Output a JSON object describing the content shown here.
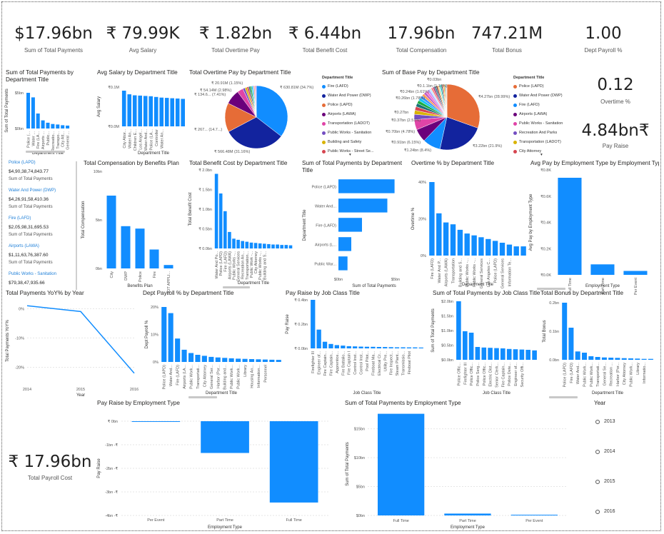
{
  "colors": {
    "bar": "#118DFF",
    "accent": "#1e7fd8"
  },
  "kpis": [
    {
      "value": "$17.96bn",
      "label": "Sum of Total Payments"
    },
    {
      "value": "₹ 79.99K",
      "label": "Avg Salary"
    },
    {
      "value": "₹ 1.82bn",
      "label": "Total Overtime Pay"
    },
    {
      "value": "₹ 6.44bn",
      "label": "Total Benefit Cost"
    },
    {
      "value": "17.96bn",
      "label": "Total Compensation"
    },
    {
      "value": "747.21M",
      "label": "Total Bonus"
    },
    {
      "value": "1.00",
      "label": "Dept Payroll %"
    }
  ],
  "side_kpis": [
    {
      "value": "0.12",
      "label": "Overtime %"
    },
    {
      "value": "4.84bn₹",
      "label": "Pay Raise"
    }
  ],
  "payroll_cost": {
    "value": "₹ 17.96bn",
    "label": "Total Payroll Cost"
  },
  "card_list": [
    {
      "name": "Police (LAPD)",
      "value": "$4,90,38,74,843.77",
      "sub": "Sum of Total Payments"
    },
    {
      "name": "Water And Power (DWP)",
      "value": "$4,26,91,58,410.36",
      "sub": "Sum of Total Payments"
    },
    {
      "name": "Fire (LAFD)",
      "value": "$2,05,98,31,695.53",
      "sub": "Sum of Total Payments"
    },
    {
      "name": "Airports (LAWA)",
      "value": "$1,11,63,76,387.60",
      "sub": "Sum of Total Payments"
    },
    {
      "name": "Public Works - Sanitation",
      "value": "$79,38,47,935.66",
      "sub": ""
    }
  ],
  "years": {
    "title": "Year",
    "items": [
      "2013",
      "2014",
      "2015",
      "2016"
    ]
  },
  "charts": {
    "dept_payments": {
      "title": "Sum of Total Payments by Department Title",
      "ylabel": "Sum of Total Payments",
      "xlabel": "Department Title",
      "ticks": [
        "$5bn",
        "$0bn"
      ],
      "categories": [
        "Police (...",
        "Water ...",
        "Fire (LA...",
        "Airports ...",
        "Public...",
        "Recreatio...",
        "Transpo...",
        "City Att...",
        "General ..."
      ],
      "values": [
        4.9,
        4.27,
        2.06,
        1.12,
        0.79,
        0.62,
        0.55,
        0.45,
        0.4
      ]
    },
    "avg_salary": {
      "title": "Avg Salary by Department Title",
      "ylabel": "Avg Salary",
      "xlabel": "Department Title",
      "ticks": [
        "₹0.1M",
        "₹0.0M"
      ],
      "categories": [
        "City Attor...",
        "Water An...",
        "Children E...",
        "Los Angel...",
        "Water And...",
        "Police (LA...",
        "Controller",
        "Water An..."
      ],
      "values": [
        0.109,
        0.098,
        0.095,
        0.094,
        0.093,
        0.092,
        0.09,
        0.088,
        0.087,
        0.086,
        0.085,
        0.084
      ]
    },
    "overtime_pie": {
      "title": "Total Overtime Pay by Department Title",
      "labels": [
        "₹ 630.81M (34.7%)",
        "₹ 566.48M (31.16%)",
        "₹ 267... (14.7...)",
        "₹ 134.6... (7.41%)",
        "₹ 54.14M (2.98%)",
        "₹ 20.91M (1.15%)"
      ],
      "values": [
        34.7,
        31.16,
        14.7,
        7.41,
        2.98,
        1.15,
        1.0,
        0.9,
        0.8,
        0.7,
        0.6,
        0.5,
        0.5,
        0.4,
        0.4
      ],
      "legend_title": "Department Title",
      "legend": [
        "Fire (LAFD)",
        "Water And Power (DWP)",
        "Police (LAPD)",
        "Airports (LAWA)",
        "Transportation (LADOT)",
        "Public Works - Sanitation",
        "Building and Safety",
        "Public Works - Street Se..."
      ],
      "colors": [
        "#118DFF",
        "#12239E",
        "#E66C37",
        "#6B007B",
        "#E044A7",
        "#744EC2",
        "#D9B300",
        "#D64550",
        "#197278",
        "#1AAB40",
        "#15C6F4",
        "#4092FF",
        "#FFA058",
        "#BE5DC9",
        "#F472D0"
      ]
    },
    "base_pie": {
      "title": "Sum of Base Pay by Department Title",
      "labels": [
        "₹4.27bn (28.99%)",
        "₹3.22bn (21.9%)",
        "₹1.24bn (8.4%)",
        "₹0.91bn (6.15%)",
        "₹0.70bn (4.78%)",
        "₹0.37bn (2.51%)",
        "₹0.27bn",
        "₹0.26bn (1.78%)",
        "₹0.24bn (1.61%)",
        "₹0.1.1bn (1.13%)",
        "₹0.03bn"
      ],
      "values": [
        28.99,
        21.9,
        8.4,
        6.15,
        4.78,
        2.51,
        1.9,
        1.78,
        1.61,
        1.5,
        1.4,
        1.3,
        1.2,
        1.13,
        1.1,
        1.0,
        0.9,
        0.9,
        0.8,
        0.8,
        0.7,
        0.7,
        0.6,
        0.6,
        0.5,
        0.5,
        0.5,
        0.4,
        0.4,
        0.3
      ],
      "legend_title": "Department Title",
      "legend": [
        "Police (LAPD)",
        "Water And Power (DWP)",
        "Fire (LAFD)",
        "Airports (LAWA)",
        "Public Works - Sanitation",
        "Recreation And Parks",
        "Transportation (LADOT)",
        "City Attorney"
      ],
      "colors": [
        "#E66C37",
        "#12239E",
        "#118DFF",
        "#6B007B",
        "#E044A7",
        "#744EC2",
        "#D9B300",
        "#D64550",
        "#197278",
        "#1AAB40",
        "#15C6F4",
        "#4092FF",
        "#FFA058",
        "#BE5DC9",
        "#F472D0",
        "#B5A1FF",
        "#C4ECFF",
        "#FF8080",
        "#A43B76",
        "#2F7C93",
        "#7F312F",
        "#FFCB6B",
        "#8AD4EB",
        "#01B8AA",
        "#374649",
        "#FD625E",
        "#F2C80F",
        "#5F6B6D",
        "#8AD4EB",
        "#FE9666"
      ]
    },
    "benefits_plan": {
      "title": "Total Compensation by Benefits Plan",
      "ylabel": "Total Compensation",
      "xlabel": "Benefits Plan",
      "ticks": [
        "10bn",
        "5bn",
        "0bn"
      ],
      "categories": [
        "City",
        "DWP",
        "Police",
        "Fire",
        "NOT APPLI..."
      ],
      "values": [
        7.5,
        4.35,
        4.1,
        1.95,
        0.35
      ]
    },
    "benefit_cost": {
      "title": "Total Benefit Cost by Department Title",
      "ylabel": "Total Benefit Cost",
      "xlabel": "Department Title",
      "ticks": [
        "₹ 2.0bn",
        "₹ 1.5bn",
        "₹ 1.0bn",
        "₹ 0.5bn",
        "₹ 0.0bn"
      ],
      "categories": [
        "Water And Po...",
        "Police (LAPD)",
        "Fire (LAFD)",
        "Airports (LAWA)",
        "Public Works -...",
        "General Services",
        "Recreation An...",
        "Transportation...",
        "Public Work -...",
        "City Attorney",
        "Public Works -...",
        "Building and S..."
      ],
      "values": [
        1.9,
        1.4,
        0.95,
        0.42,
        0.25,
        0.22,
        0.19,
        0.17,
        0.15,
        0.14,
        0.13,
        0.12,
        0.11,
        0.1,
        0.1,
        0.09,
        0.09,
        0.08
      ]
    },
    "dept_payments_h": {
      "title": "Sum of Total Payments by Department Title",
      "ylabel": "Department Title",
      "xlabel": "Sum of Total Payments",
      "ticks": [
        "$0bn",
        "$5bn"
      ],
      "categories": [
        "Police (LAPD)",
        "Water And...",
        "Fire (LAFD)",
        "Airports (L...",
        "Public War..."
      ],
      "values": [
        4.9,
        4.27,
        2.06,
        1.12,
        0.79
      ]
    },
    "overtime_pct": {
      "title": "Overtime % by Department Title",
      "ylabel": "Overtime %",
      "xlabel": "Department Title",
      "ticks": [
        "40%",
        "20%",
        "0%"
      ],
      "categories": [
        "Fire (LAFD)",
        "Water And P...",
        "Airports (LAWA)",
        "Transportation",
        "Building and S...",
        "Public Works -...",
        "Public Works -...",
        "General Services",
        "Los Angeles C...",
        "Police (LAPD)",
        "General Services",
        "Information Te..."
      ],
      "values": [
        40,
        23,
        18,
        17,
        14,
        12,
        11,
        10,
        9,
        8,
        7,
        6,
        5,
        5
      ]
    },
    "emp_type_avg": {
      "title": "Avg Pay by Employment Type by Employment Type",
      "ylabel": "Avg Pay by Employment Type",
      "xlabel": "Employment Type",
      "ticks": [
        "₹0.8K",
        "₹0.6K",
        "₹0.4K",
        "₹0.2K",
        "₹0.0K"
      ],
      "categories": [
        "Full Time",
        "Part Time",
        "Per Event"
      ],
      "values": [
        0.74,
        0.08,
        0.03
      ]
    },
    "yoy": {
      "title": "Total Payments YoY% by Year",
      "ylabel": "Total Payments YoY%",
      "xlabel": "Year",
      "ticks": [
        "0%",
        "-10%",
        "-20%"
      ],
      "x": [
        "2014",
        "2015",
        "2016"
      ],
      "values": [
        1,
        -1,
        -22
      ]
    },
    "dept_payroll": {
      "title": "Dept Payroll % by Department Title",
      "ylabel": "Dept Payroll %",
      "xlabel": "Department Title",
      "ticks": [
        "20%",
        "10%",
        "0%"
      ],
      "categories": [
        "Police (LAPD)",
        "Water And...",
        "Fire (LAFD)",
        "Airports (LA...",
        "Public Work...",
        "Transportati...",
        "City Attorney",
        "General Ser...",
        "Harbor (Por...",
        "Building and...",
        "Public Work...",
        "Public Work...",
        "Library",
        "Housing An...",
        "Information...",
        "Personnel"
      ],
      "values": [
        27,
        24,
        11.5,
        6,
        4.4,
        3.5,
        3,
        2.5,
        2.2,
        2,
        1.8,
        1.6,
        1.5,
        1.4,
        1.3,
        1.2,
        1.1,
        1
      ]
    },
    "job_raise": {
      "title": "Pay Raise by Job Class Title",
      "ylabel": "Pay Raise",
      "xlabel": "Job Class Title",
      "ticks": [
        "₹ 0.4bn",
        "₹ 0.2bn",
        "₹ 0.0bn"
      ],
      "categories": [
        "Firefighter III",
        "Engineer of...",
        "Fire Captain...",
        "Fire Captain...",
        "Apprentice...",
        "Fire Battalio...",
        "Fire Captain I",
        "Control Inst...",
        "Control Inst...",
        "Pool Pilot...",
        "Fireboat Ma...",
        "Electrical Cr...",
        "Utility Pre...",
        "Fire Inspect...",
        "Steam Plant...",
        "Transmissio...",
        "Fireboat Pilot"
      ],
      "values": [
        0.44,
        0.17,
        0.06,
        0.04,
        0.03,
        0.025,
        0.02,
        0.018,
        0.016,
        0.015,
        0.014,
        0.013,
        0.012,
        0.011,
        0.01,
        0.01,
        0.009,
        0.009,
        0.008
      ]
    },
    "job_payments": {
      "title": "Sum of Total Payments by Job Class Title",
      "ylabel": "Sum of Total Payments",
      "xlabel": "Job Class Title",
      "ticks": [
        "$2.0bn",
        "$1.5bn",
        "$1.0bn",
        "$0.5bn",
        "$0.0bn"
      ],
      "categories": [
        "Police Offic...",
        "Firefighter III",
        "Police Offic...",
        "Police Serg...",
        "Police Offic...",
        "Electric Dist...",
        "Senior Clerk...",
        "Fire Captain...",
        "Police Dete...",
        "Engineer of...",
        "Security Offi..."
      ],
      "values": [
        2.05,
        1.0,
        0.95,
        0.45,
        0.43,
        0.42,
        0.41,
        0.4,
        0.38,
        0.37,
        0.36,
        0.35,
        0.33
      ]
    },
    "bonus": {
      "title": "Total Bonus by Department Title",
      "ylabel": "Total Bonus",
      "xlabel": "Department Title",
      "ticks": [
        "0.2bn",
        "0.1bn",
        "0.0bn"
      ],
      "categories": [
        "Police (LAPD)",
        "Fire (LAFD)",
        "Water And...",
        "Public Work...",
        "Public Work...",
        "Transportati...",
        "General Se...",
        "Recreation ...",
        "Harbor (Por...",
        "City Attorney",
        "Public Work...",
        "Library",
        "Informatio..."
      ],
      "values": [
        0.24,
        0.135,
        0.035,
        0.03,
        0.015,
        0.012,
        0.01,
        0.009,
        0.008,
        0.007,
        0.006,
        0.005,
        0.004,
        0.004
      ]
    },
    "emp_raise": {
      "title": "Pay Raise by Employment Type",
      "ylabel": "Pay Raise",
      "xlabel": "Employment Type",
      "ticks": [
        "₹ 0bn",
        "-1bn -₹",
        "-2bn -₹",
        "-3bn -₹",
        "-4bn -₹"
      ],
      "categories": [
        "Per Event",
        "Part Time",
        "Full Time"
      ],
      "values": [
        -0.02,
        -1.35,
        -3.45
      ]
    },
    "emp_payments": {
      "title": "Sum of Total Payments by Employment Type",
      "ylabel": "Sum of Total Payments",
      "xlabel": "Employment Type",
      "ticks": [
        "$15bn",
        "$10bn",
        "$5bn",
        "$0bn"
      ],
      "categories": [
        "Full Time",
        "Part Time",
        "Per Event"
      ],
      "values": [
        17.6,
        0.32,
        0.05
      ]
    }
  }
}
